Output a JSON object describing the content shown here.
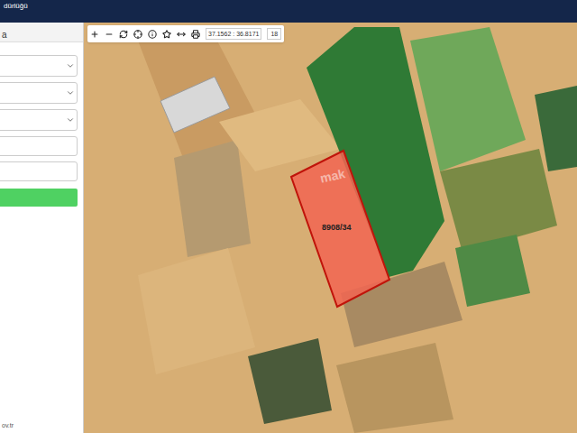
{
  "window": {
    "title": "dürlüğü"
  },
  "sidebar": {
    "header": "a",
    "fields": [
      {
        "kind": "select"
      },
      {
        "kind": "select"
      },
      {
        "kind": "select"
      },
      {
        "kind": "input"
      },
      {
        "kind": "input"
      }
    ],
    "footer": "ov.tr"
  },
  "map": {
    "coordinates": "37.1562 : 36.8171",
    "zoom": "18",
    "parcel": {
      "label": "8908/34",
      "color": "#f26552"
    },
    "watermark": "mak"
  }
}
